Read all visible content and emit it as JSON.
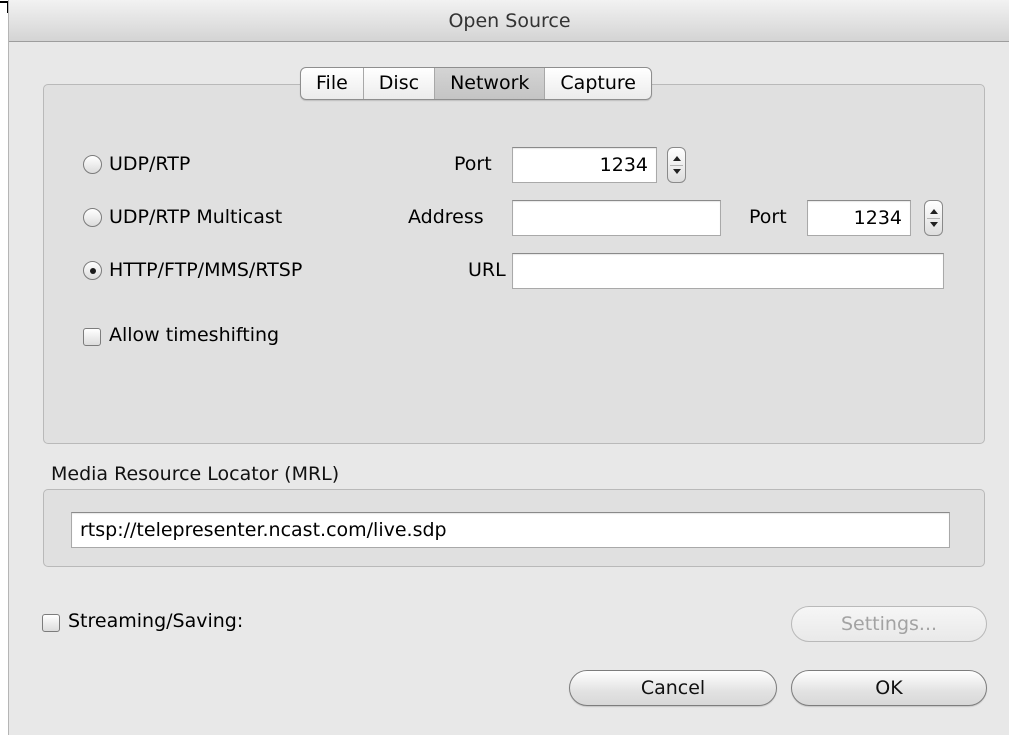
{
  "window": {
    "title": "Open Source"
  },
  "tabs": [
    {
      "label": "File",
      "active": false
    },
    {
      "label": "Disc",
      "active": false
    },
    {
      "label": "Network",
      "active": true
    },
    {
      "label": "Capture",
      "active": false
    }
  ],
  "network": {
    "udp_rtp": {
      "label": "UDP/RTP",
      "selected": false,
      "port_label": "Port",
      "port_value": "1234"
    },
    "udp_multicast": {
      "label": "UDP/RTP Multicast",
      "selected": false,
      "address_label": "Address",
      "address_value": "",
      "port_label": "Port",
      "port_value": "1234"
    },
    "http": {
      "label": "HTTP/FTP/MMS/RTSP",
      "selected": true,
      "url_label": "URL",
      "url_value": ""
    },
    "timeshift": {
      "label": "Allow timeshifting",
      "checked": false
    }
  },
  "mrl": {
    "title": "Media Resource Locator (MRL)",
    "value": "rtsp://telepresenter.ncast.com/live.sdp"
  },
  "streaming": {
    "label": "Streaming/Saving:",
    "checked": false
  },
  "buttons": {
    "settings": "Settings...",
    "cancel": "Cancel",
    "ok": "OK"
  }
}
